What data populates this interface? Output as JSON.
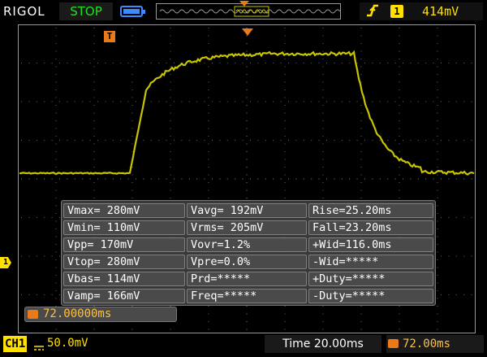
{
  "header": {
    "brand": "RIGOL",
    "run_state": "STOP",
    "trigger": {
      "edge_icon": "rising-edge-icon",
      "channel": "1",
      "level": "414mV"
    }
  },
  "markers": {
    "trigger_position_label": "T",
    "channel_marker_label": "1"
  },
  "measurements": {
    "rows": [
      [
        "Vmax= 280mV",
        "Vavg= 192mV",
        "Rise=25.20ms"
      ],
      [
        "Vmin= 110mV",
        "Vrms= 205mV",
        "Fall=23.20ms"
      ],
      [
        "Vpp= 170mV",
        "Vovr=1.2%",
        "+Wid=116.0ms"
      ],
      [
        "Vtop= 280mV",
        "Vpre=0.0%",
        "-Wid=*****"
      ],
      [
        "Vbas= 114mV",
        "Prd=*****",
        "+Duty=*****"
      ],
      [
        "Vamp= 166mV",
        "Freq=*****",
        "-Duty=*****"
      ]
    ]
  },
  "trigger_delay": "72.00000ms",
  "footer": {
    "channel": "CH1",
    "volts_per_div": "50.0mV",
    "timebase": "Time 20.00ms",
    "delay": "72.00ms"
  },
  "colors": {
    "trace": "#c8c400",
    "channel": "#ffe000",
    "accent": "#e87a1a",
    "stop": "#1ee31e"
  }
}
